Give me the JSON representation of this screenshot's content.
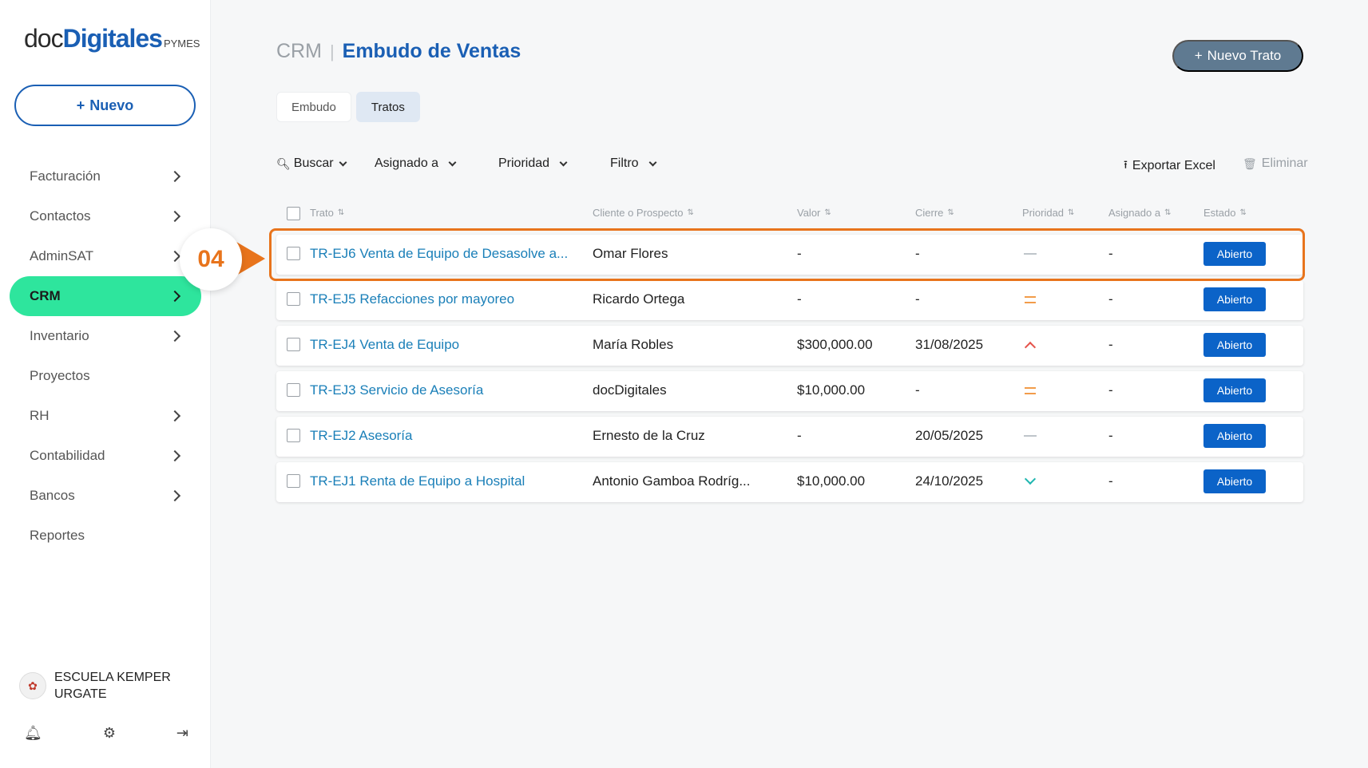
{
  "logo": {
    "doc": "doc",
    "digitales": "Digitales",
    "pymes": "PYMES"
  },
  "sidebar": {
    "new_label": "Nuevo",
    "items": [
      {
        "label": "Facturación",
        "has_chevron": true
      },
      {
        "label": "Contactos",
        "has_chevron": true
      },
      {
        "label": "AdminSAT",
        "has_chevron": true
      },
      {
        "label": "CRM",
        "has_chevron": true,
        "active": true
      },
      {
        "label": "Inventario",
        "has_chevron": true
      },
      {
        "label": "Proyectos",
        "has_chevron": false
      },
      {
        "label": "RH",
        "has_chevron": true
      },
      {
        "label": "Contabilidad",
        "has_chevron": true
      },
      {
        "label": "Bancos",
        "has_chevron": true
      },
      {
        "label": "Reportes",
        "has_chevron": false
      }
    ],
    "account_name": "ESCUELA KEMPER URGATE",
    "bottom_icons": [
      "bell-icon",
      "gear-icon",
      "logout-icon"
    ]
  },
  "callout": {
    "step": "04",
    "color": "#e8741c"
  },
  "header": {
    "module": "CRM",
    "separator": "|",
    "page_title": "Embudo de Ventas",
    "new_deal_label": "Nuevo Trato"
  },
  "tabs": [
    {
      "label": "Embudo",
      "active": false
    },
    {
      "label": "Tratos",
      "active": true
    }
  ],
  "filters": {
    "search": "Buscar",
    "assigned": "Asignado a",
    "priority": "Prioridad",
    "filter": "Filtro",
    "export": "Exportar Excel",
    "delete": "Eliminar"
  },
  "table": {
    "columns": [
      "Trato",
      "Cliente o Prospecto",
      "Valor",
      "Cierre",
      "Prioridad",
      "Asignado a",
      "Estado"
    ],
    "rows": [
      {
        "deal": "TR-EJ6 Venta de Equipo de Desasolve a...",
        "client": "Omar Flores",
        "value": "-",
        "close": "-",
        "priority": "low",
        "assigned": "-",
        "status": "Abierto",
        "highlighted": true
      },
      {
        "deal": "TR-EJ5 Refacciones por mayoreo",
        "client": "Ricardo Ortega",
        "value": "-",
        "close": "-",
        "priority": "medium",
        "assigned": "-",
        "status": "Abierto"
      },
      {
        "deal": "TR-EJ4 Venta de Equipo",
        "client": "María Robles",
        "value": "$300,000.00",
        "close": "31/08/2025",
        "priority": "high",
        "assigned": "-",
        "status": "Abierto"
      },
      {
        "deal": "TR-EJ3 Servicio de Asesoría",
        "client": "docDigitales",
        "value": "$10,000.00",
        "close": "-",
        "priority": "medium",
        "assigned": "-",
        "status": "Abierto"
      },
      {
        "deal": "TR-EJ2 Asesoría",
        "client": "Ernesto de la Cruz",
        "value": "-",
        "close": "20/05/2025",
        "priority": "low",
        "assigned": "-",
        "status": "Abierto"
      },
      {
        "deal": "TR-EJ1 Renta de Equipo a Hospital",
        "client": "Antonio Gamboa Rodríg...",
        "value": "$10,000.00",
        "close": "24/10/2025",
        "priority": "lowest",
        "assigned": "-",
        "status": "Abierto"
      }
    ]
  },
  "colors": {
    "accent": "#1a5fb4",
    "active_nav": "#2ee59d",
    "status_badge": "#0b63c8",
    "highlight": "#e8741c"
  }
}
